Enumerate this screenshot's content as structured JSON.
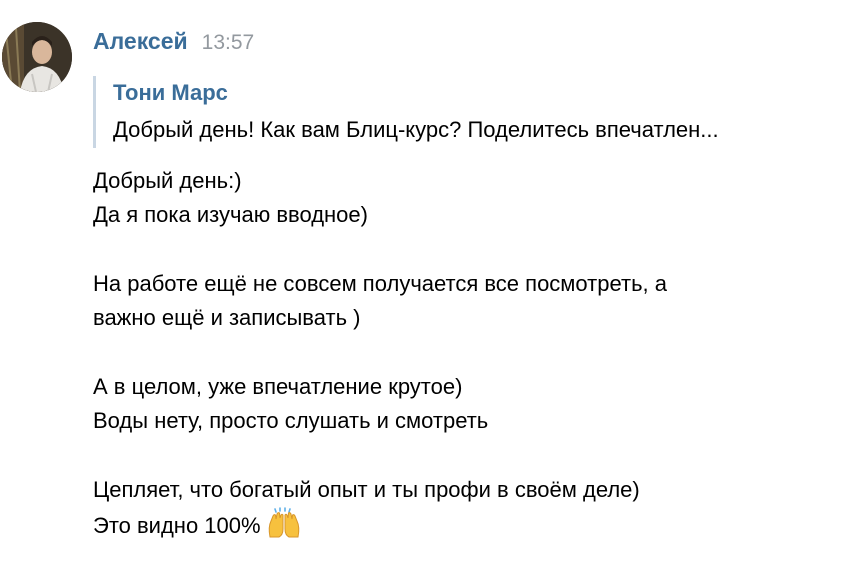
{
  "message": {
    "author": "Алексей",
    "time": "13:57",
    "avatar_icon": "user-photo-avatar",
    "reply": {
      "author": "Тони Марс",
      "text": "Добрый день! Как вам Блиц-курс? Поделитесь впечатлен..."
    },
    "lines": [
      "Добрый день:)",
      "Да я пока изучаю вводное)",
      "На работе ещё не совсем получается все посмотреть, а",
      "важно ещё и записывать )",
      "А в целом, уже впечатление крутое)",
      "Воды нету, просто слушать и смотреть",
      "Цепляет, что богатый опыт и ты профи в своём деле)",
      "Это видно 100%"
    ],
    "emoji": "raising-hands-emoji",
    "colors": {
      "author": "#3a6d99",
      "time": "#93999f",
      "reply_bar": "#c9d6e3"
    }
  }
}
